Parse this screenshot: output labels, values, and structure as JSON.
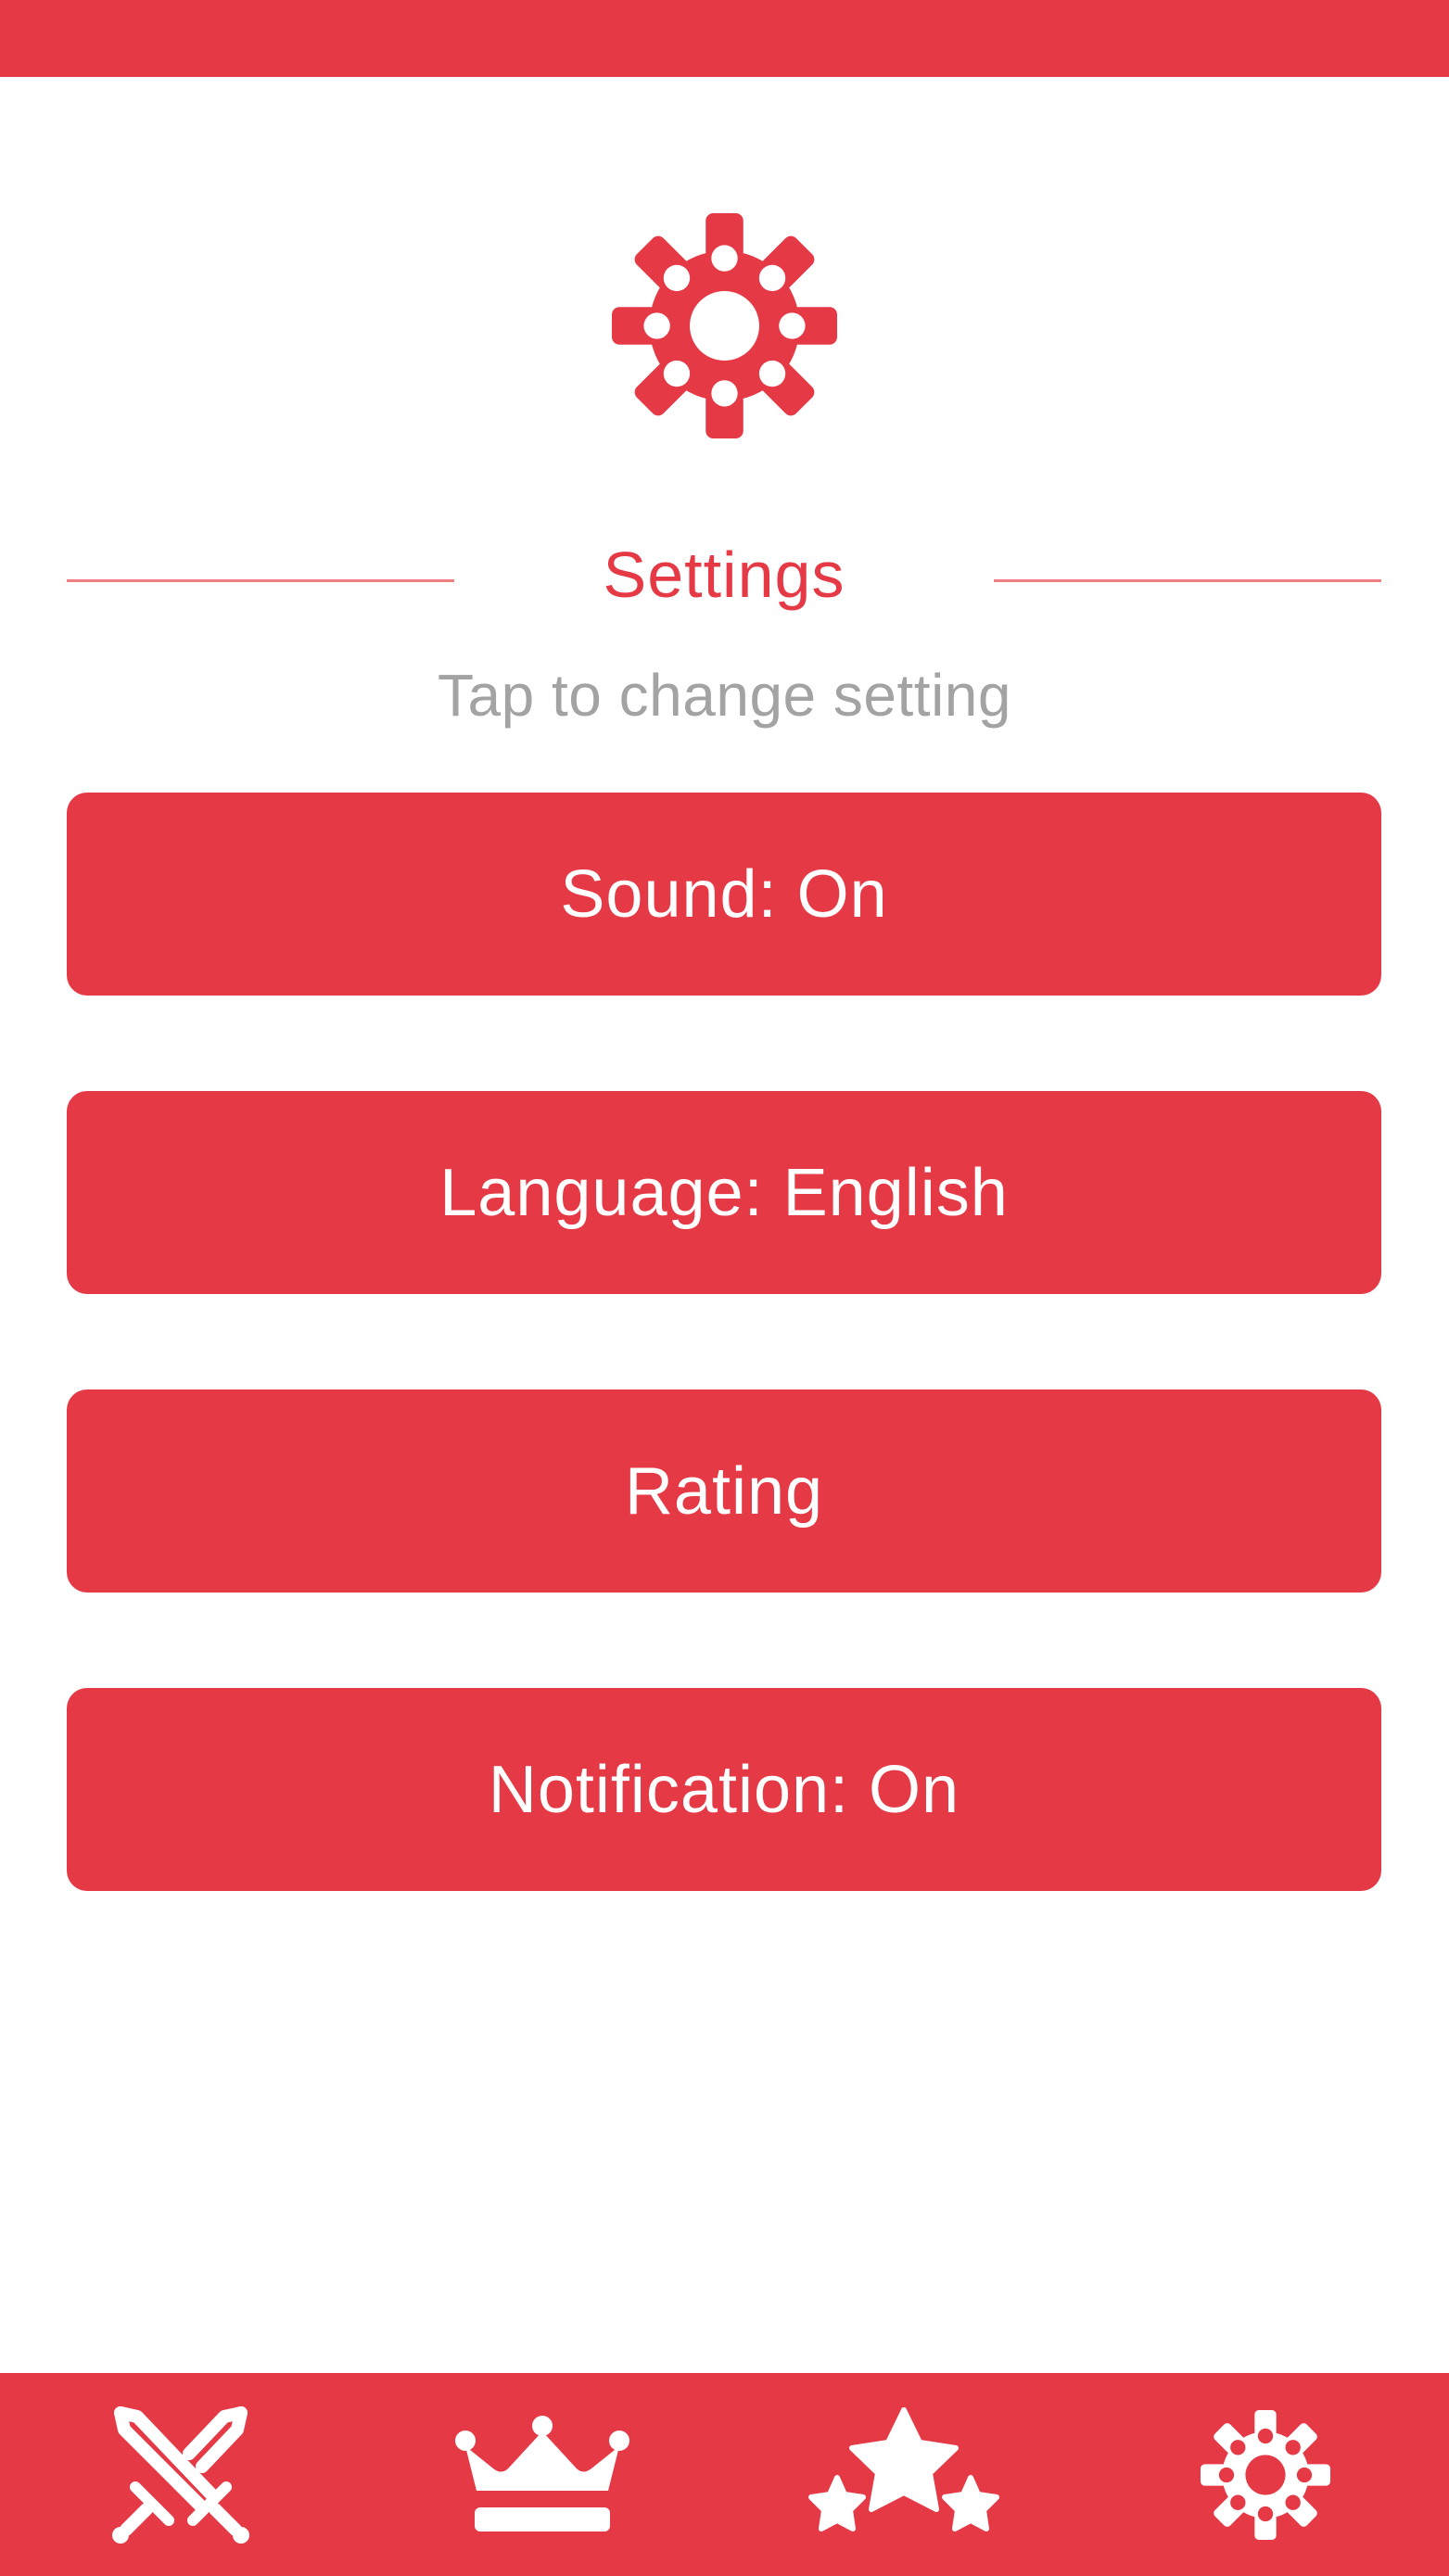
{
  "colors": {
    "accent": "#e63946",
    "divider": "#f08080",
    "subtitle": "#a3a3a3",
    "background": "#ffffff",
    "on_accent": "#ffffff"
  },
  "header": {
    "icon": "gear-icon",
    "title": "Settings",
    "subtitle": "Tap to change setting"
  },
  "settings": {
    "sound": "Sound: On",
    "language": "Language: English",
    "rating": "Rating",
    "notification": "Notification: On"
  },
  "bottom_nav": {
    "items": [
      {
        "icon": "crossed-swords-icon"
      },
      {
        "icon": "crown-icon"
      },
      {
        "icon": "stars-icon"
      },
      {
        "icon": "gear-icon"
      }
    ]
  }
}
